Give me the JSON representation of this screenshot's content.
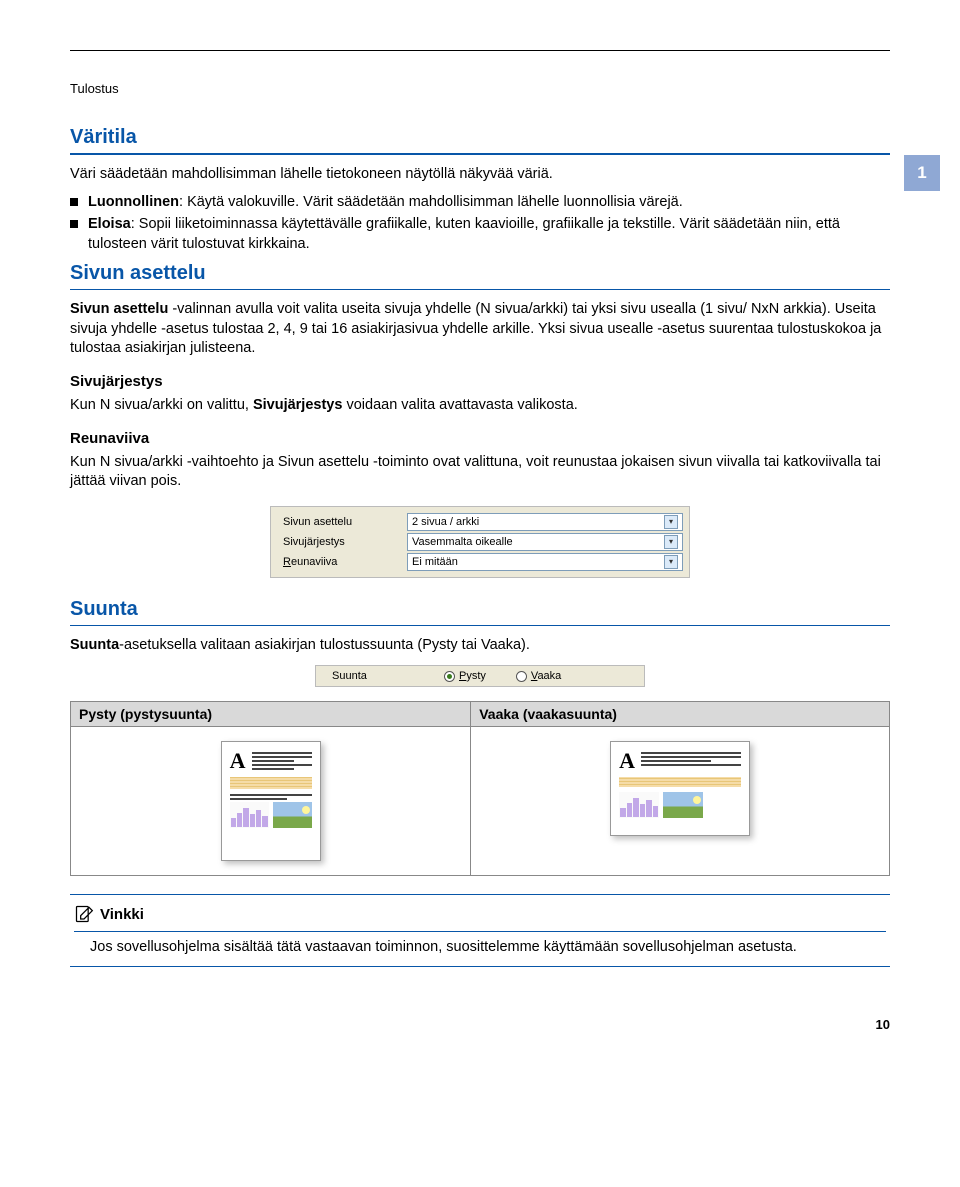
{
  "breadcrumb": "Tulostus",
  "section_number": "1",
  "section_varitila": {
    "heading": "Väritila",
    "intro": "Väri säädetään mahdollisimman lähelle tietokoneen näytöllä näkyvää väriä.",
    "bullets": {
      "b1_label": "Luonnollinen",
      "b1_text": ": Käytä valokuville. Värit säädetään mahdollisimman lähelle luonnollisia värejä.",
      "b2_label": "Eloisa",
      "b2_text": ": Sopii liiketoiminnassa käytettävälle grafiikalle, kuten kaavioille, grafiikalle ja tekstille. Värit säädetään niin, että tulosteen värit tulostuvat kirkkaina."
    }
  },
  "section_asettelu": {
    "heading": "Sivun asettelu",
    "para": {
      "pre": "",
      "bold1": "Sivun asettelu",
      "rest": " -valinnan avulla voit valita useita sivuja yhdelle (N sivua/arkki) tai yksi sivu usealla (1 sivu/ NxN arkkia). Useita sivuja yhdelle -asetus tulostaa 2, 4, 9 tai 16 asiakirjasivua yhdelle arkille. Yksi sivua usealle -asetus suurentaa tulostuskokoa ja tulostaa asiakirjan julisteena."
    },
    "sub_sivujarjestys": {
      "heading": "Sivujärjestys",
      "text_pre": "Kun N sivua/arkki on valittu, ",
      "bold": "Sivujärjestys",
      "text_post": " voidaan valita avattavasta valikosta."
    },
    "sub_reunaviiva": {
      "heading": "Reunaviiva",
      "text": "Kun N sivua/arkki -vaihtoehto ja Sivun asettelu -toiminto ovat valittuna, voit reunustaa jokaisen sivun viivalla tai katkoviivalla tai jättää viivan pois."
    },
    "panel": {
      "row1_label": "Sivun asettelu",
      "row1_value": "2 sivua / arkki",
      "row2_label_pre": "Sivu",
      "row2_label_u": "j",
      "row2_label_post": "ärjestys",
      "row2_value": "Vasemmalta oikealle",
      "row3_label_u": "R",
      "row3_label_rest": "eunaviiva",
      "row3_value": "Ei mitään"
    }
  },
  "section_suunta": {
    "heading": "Suunta",
    "intro_bold": "Suunta",
    "intro_rest": "-asetuksella valitaan asiakirjan tulostussuunta (Pysty tai Vaaka).",
    "radio": {
      "label": "Suunta",
      "opt1_u": "P",
      "opt1_rest": "ysty",
      "opt2_u": "V",
      "opt2_rest": "aaka"
    },
    "table": {
      "th1": "Pysty (pystysuunta)",
      "th2": "Vaaka (vaakasuunta)"
    }
  },
  "note": {
    "heading": "Vinkki",
    "body": "Jos sovellusohjelma sisältää tätä vastaavan toiminnon, suosittelemme käyttämään sovellusohjelman asetusta."
  },
  "page_number": "10"
}
